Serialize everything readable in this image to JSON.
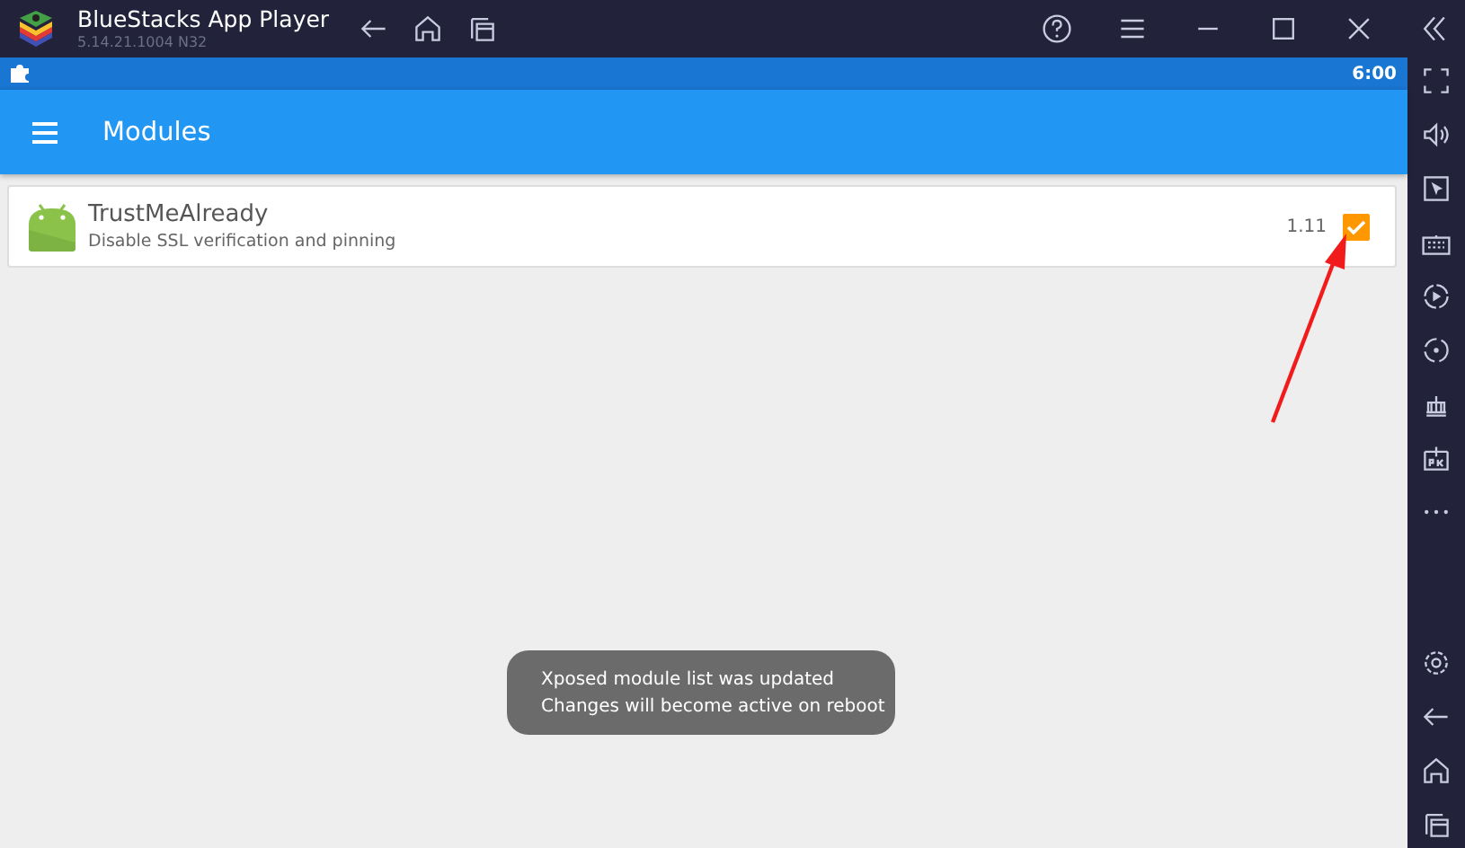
{
  "window": {
    "title": "BlueStacks App Player",
    "version": "5.14.21.1004  N32"
  },
  "status_bar": {
    "time": "6:00"
  },
  "app_bar": {
    "title": "Modules"
  },
  "modules": [
    {
      "name": "TrustMeAlready",
      "description": "Disable SSL verification and pinning",
      "version": "1.11",
      "checked": true
    }
  ],
  "toast": {
    "lines": [
      "Xposed module list was updated",
      "Changes will become active on reboot"
    ]
  }
}
